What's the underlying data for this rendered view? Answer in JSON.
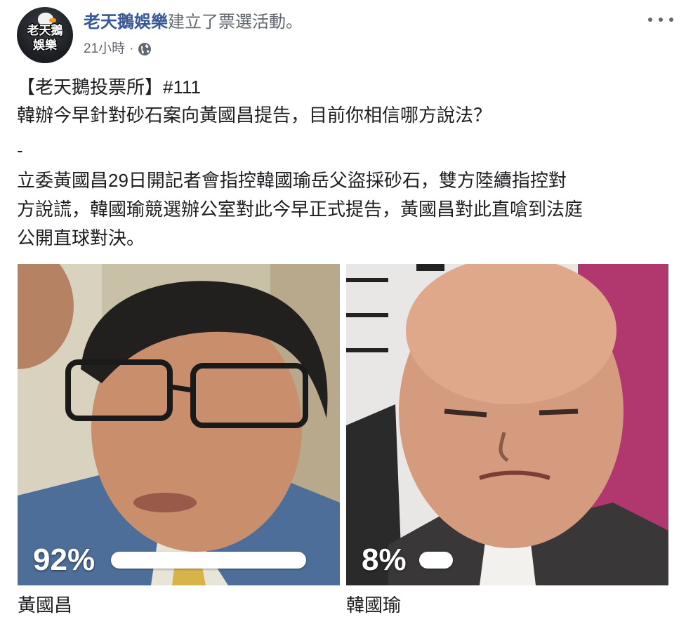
{
  "post": {
    "author": "老天鵝娛樂",
    "action": "建立了票選活動。",
    "time": "21小時",
    "separator": "·",
    "privacy_icon": "globe-icon",
    "avatar_text": "老天鵝\n娛樂",
    "more_icon": "more-options-icon"
  },
  "body": {
    "line1": "【老天鵝投票所】#111",
    "line2": "韓辦今早針對砂石案向黃國昌提告，目前你相信哪方說法？",
    "dash": "-",
    "line4": "立委黃國昌29日開記者會指控韓國瑜岳父盜採砂石，雙方陸續指控對",
    "line5": "方說謊，韓國瑜競選辦公室對此今早正式提告，黃國昌對此直嗆到法庭",
    "line6": "公開直球對決。"
  },
  "poll": {
    "options": [
      {
        "label": "黃國昌",
        "percent_text": "92%",
        "fraction": 0.92
      },
      {
        "label": "韓國瑜",
        "percent_text": "8%",
        "fraction": 0.08
      }
    ]
  },
  "colors": {
    "author_link": "#385898",
    "secondary_text": "#606770",
    "primary_text": "#1c1e21",
    "bar": "#ffffff"
  }
}
